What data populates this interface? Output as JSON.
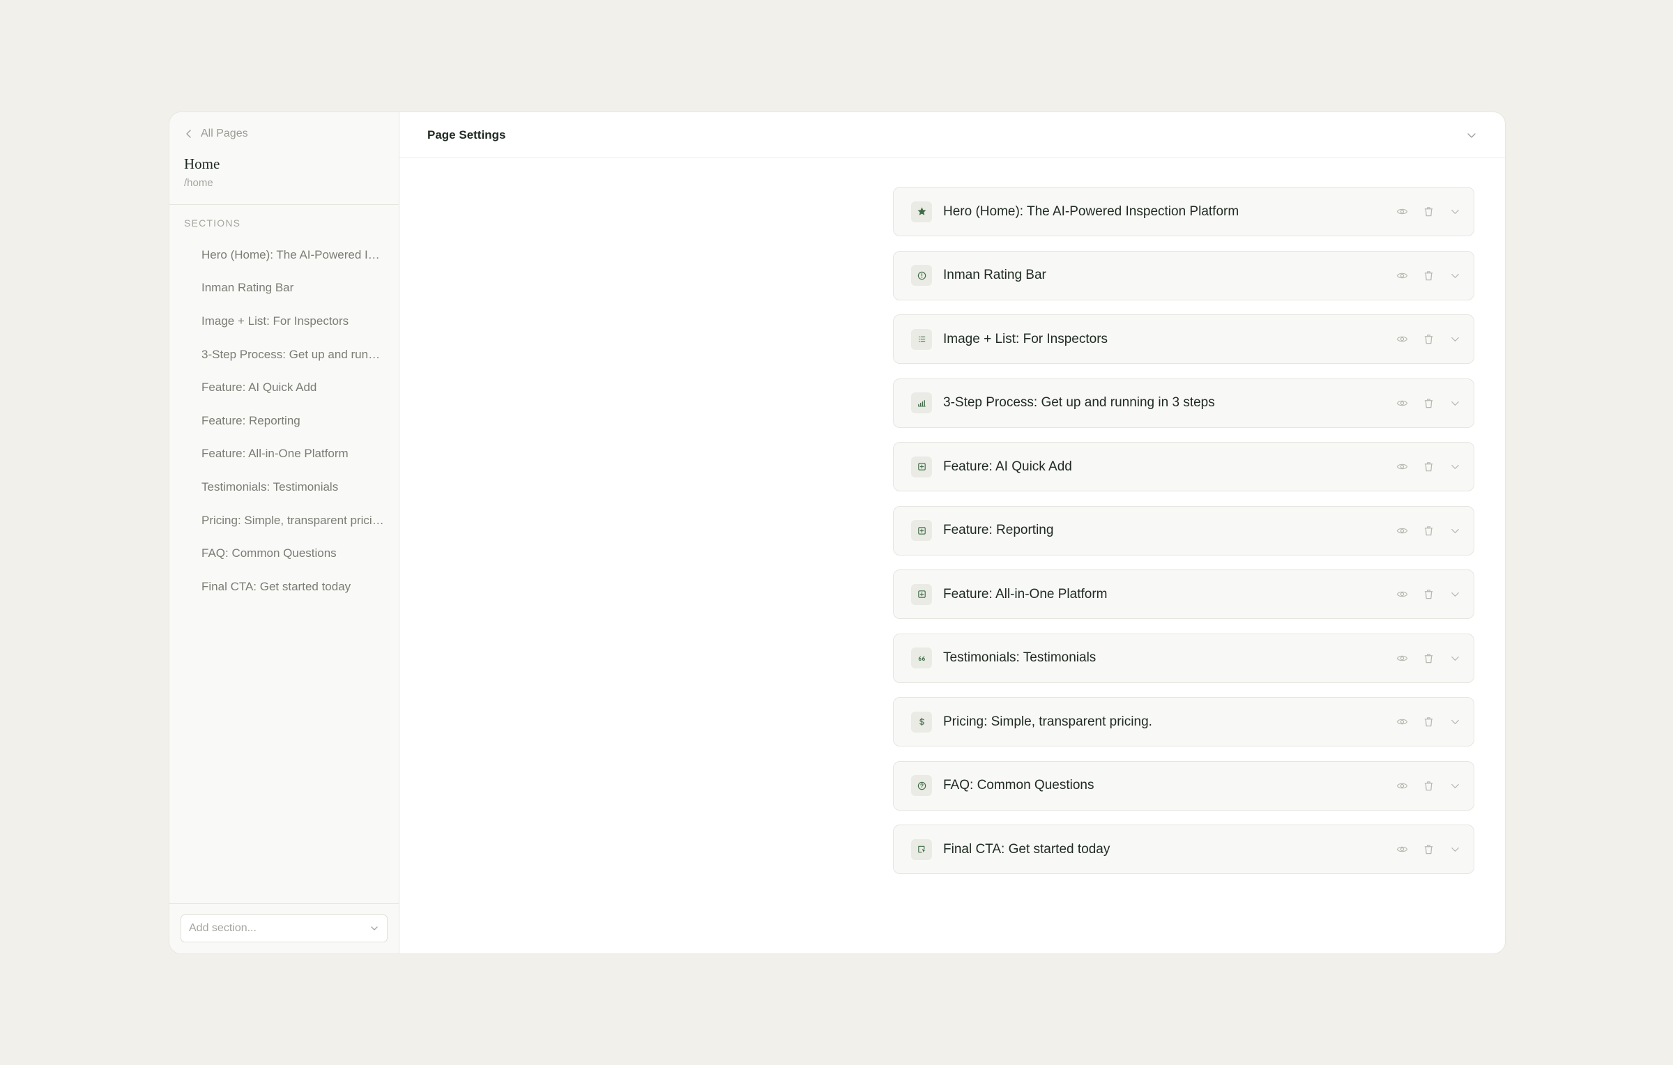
{
  "sidebar": {
    "back_label": "All Pages",
    "page_title": "Home",
    "page_slug": "/home",
    "sections_heading": "SECTIONS",
    "items": [
      "Hero (Home): The AI-Powered Inspection Platform",
      "Inman Rating Bar",
      "Image + List: For Inspectors",
      "3-Step Process: Get up and running in 3 steps",
      "Feature: AI Quick Add",
      "Feature: Reporting",
      "Feature: All-in-One Platform",
      "Testimonials: Testimonials",
      "Pricing: Simple, transparent pricing.",
      "FAQ: Common Questions",
      "Final CTA: Get started today"
    ],
    "add_section_placeholder": "Add section..."
  },
  "main": {
    "header_title": "Page Settings",
    "cards": [
      {
        "title": "Hero (Home): The AI-Powered Inspection Platform",
        "icon": "star-icon"
      },
      {
        "title": "Inman Rating Bar",
        "icon": "info-circle-icon"
      },
      {
        "title": "Image + List: For Inspectors",
        "icon": "list-icon"
      },
      {
        "title": "3-Step Process: Get up and running in 3 steps",
        "icon": "steps-icon"
      },
      {
        "title": "Feature: AI Quick Add",
        "icon": "feature-box-icon"
      },
      {
        "title": "Feature: Reporting",
        "icon": "feature-box-icon"
      },
      {
        "title": "Feature: All-in-One Platform",
        "icon": "feature-box-icon"
      },
      {
        "title": "Testimonials: Testimonials",
        "icon": "quote-icon"
      },
      {
        "title": "Pricing: Simple, transparent pricing.",
        "icon": "dollar-icon"
      },
      {
        "title": "FAQ: Common Questions",
        "icon": "question-circle-icon"
      },
      {
        "title": "Final CTA: Get started today",
        "icon": "cta-pointer-icon"
      }
    ]
  },
  "colors": {
    "background": "#f1f0ea",
    "accent": "#3f6b47",
    "text": "#1f2a22",
    "muted": "#7a7d75"
  }
}
